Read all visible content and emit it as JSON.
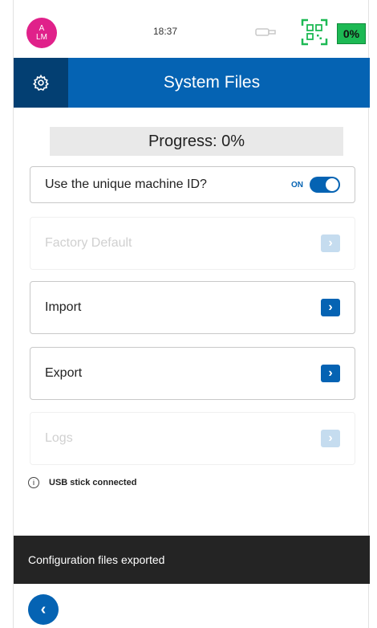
{
  "status_bar": {
    "avatar_initials_top": "A",
    "avatar_initials_bottom": "LM",
    "time": "18:37",
    "battery": "0%",
    "icons": [
      "usb-icon",
      "qr-code-icon"
    ]
  },
  "header": {
    "title": "System Files",
    "settings_icon": "gear-icon"
  },
  "progress": {
    "label": "Progress: 0%"
  },
  "rows": {
    "machine_id": {
      "label": "Use the unique machine ID?",
      "toggle_state": "ON"
    },
    "factory_default": {
      "label": "Factory Default"
    },
    "import": {
      "label": "Import"
    },
    "export": {
      "label": "Export"
    },
    "logs": {
      "label": "Logs"
    }
  },
  "usb_status": "USB stick connected",
  "toast": "Configuration files exported",
  "colors": {
    "primary": "#0563b3",
    "header_dark": "#033f72",
    "avatar": "#e0218a",
    "battery": "#1db954",
    "toast_bg": "#242424"
  }
}
